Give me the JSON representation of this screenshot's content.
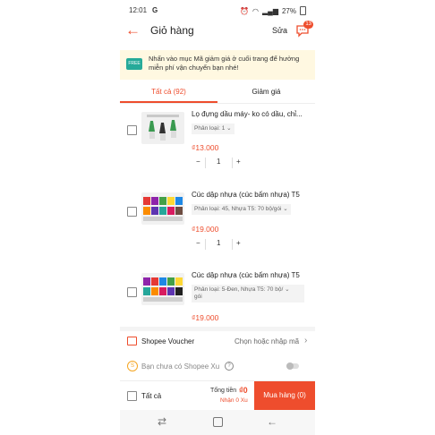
{
  "status": {
    "time": "12:01",
    "g": "G",
    "battery": "27%"
  },
  "header": {
    "title": "Giỏ hàng",
    "edit": "Sửa",
    "chat_badge": "13"
  },
  "banner": {
    "badge": "FREE",
    "text": "Nhấn vào mục Mã giảm giá ở cuối trang để hưởng miễn phí vận chuyển bạn nhé!"
  },
  "tabs": [
    {
      "label": "Tất cả (92)"
    },
    {
      "label": "Giảm giá"
    }
  ],
  "items": [
    {
      "name": "Lọ đựng dầu máy- ko có dầu, chỉ...",
      "variant": "Phân loại: 1",
      "price": "₫13.000",
      "qty": "1"
    },
    {
      "name": "Cúc dập nhựa (cúc bấm nhựa) T5",
      "variant": "Phân loại: 45, Nhựa T5: 70 bộ/gói",
      "price": "₫19.000",
      "qty": "1"
    },
    {
      "name": "Cúc dập nhựa (cúc bấm nhựa) T5",
      "variant_line1": "Phân loại: 5-Đen, Nhựa T5: 70 bộ/",
      "variant_line2": "gói",
      "price": "₫19.000"
    }
  ],
  "voucher": {
    "label": "Shopee Voucher",
    "action": "Chọn hoặc nhập mã"
  },
  "xu": {
    "label": "Bạn chưa có Shopee Xu",
    "help": "?"
  },
  "footer": {
    "select_all": "Tất cả",
    "total_label": "Tổng tiền",
    "total_value": "₫0",
    "coins": "Nhận 0 Xu",
    "buy": "Mua hàng (0)"
  },
  "colors": {
    "accent": "#ee4d2d",
    "banner_bg": "#fff8e1"
  }
}
